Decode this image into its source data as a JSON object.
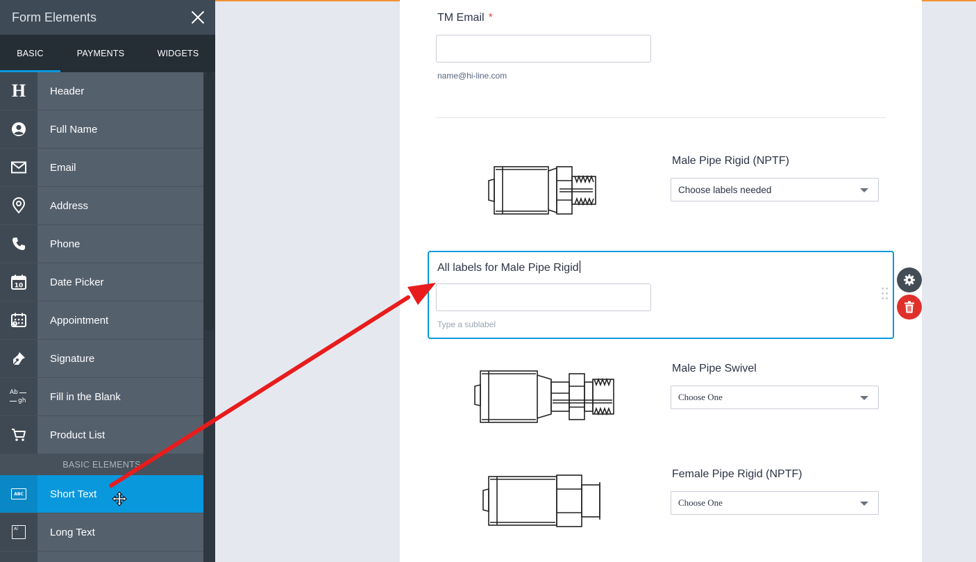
{
  "sidebar": {
    "title": "Form Elements",
    "tabs": [
      {
        "label": "BASIC",
        "active": true
      },
      {
        "label": "PAYMENTS",
        "active": false
      },
      {
        "label": "WIDGETS",
        "active": false
      }
    ],
    "items": [
      {
        "label": "Header",
        "icon": "header-icon"
      },
      {
        "label": "Full Name",
        "icon": "user-icon"
      },
      {
        "label": "Email",
        "icon": "envelope-icon"
      },
      {
        "label": "Address",
        "icon": "map-pin-icon"
      },
      {
        "label": "Phone",
        "icon": "phone-icon"
      },
      {
        "label": "Date Picker",
        "icon": "calendar-icon"
      },
      {
        "label": "Appointment",
        "icon": "appointment-icon"
      },
      {
        "label": "Signature",
        "icon": "pen-icon"
      },
      {
        "label": "Fill in the Blank",
        "icon": "fill-blank-icon"
      },
      {
        "label": "Product List",
        "icon": "cart-icon"
      }
    ],
    "section_label": "BASIC ELEMENTS",
    "basic_items": [
      {
        "label": "Short Text",
        "icon": "short-text-icon",
        "selected": true
      },
      {
        "label": "Long Text",
        "icon": "long-text-icon",
        "selected": false
      }
    ],
    "header_icon_glyph": "H",
    "fill_blank_glyph_top": "Ab",
    "fill_blank_glyph_bottom": "gh",
    "short_text_glyph": "ABC",
    "long_text_glyph": "AI"
  },
  "form": {
    "email_field": {
      "label": "TM Email",
      "required_mark": "*",
      "value": "",
      "sublabel": "name@hi-line.com"
    },
    "products": [
      {
        "label": "Male Pipe Rigid (NPTF)",
        "select_value": "Choose labels needed"
      },
      {
        "label": "Male Pipe Swivel",
        "select_value": "Choose One"
      },
      {
        "label": "Female Pipe Rigid (NPTF)",
        "select_value": "Choose One"
      }
    ],
    "selected_field": {
      "label": "All labels for Male Pipe Rigid",
      "value": "",
      "sublabel_placeholder": "Type a sublabel"
    }
  },
  "colors": {
    "accent": "#0a98dc",
    "delete": "#e0302b",
    "annotation_arrow": "#e81c1c",
    "top_bar": "#f29130"
  }
}
